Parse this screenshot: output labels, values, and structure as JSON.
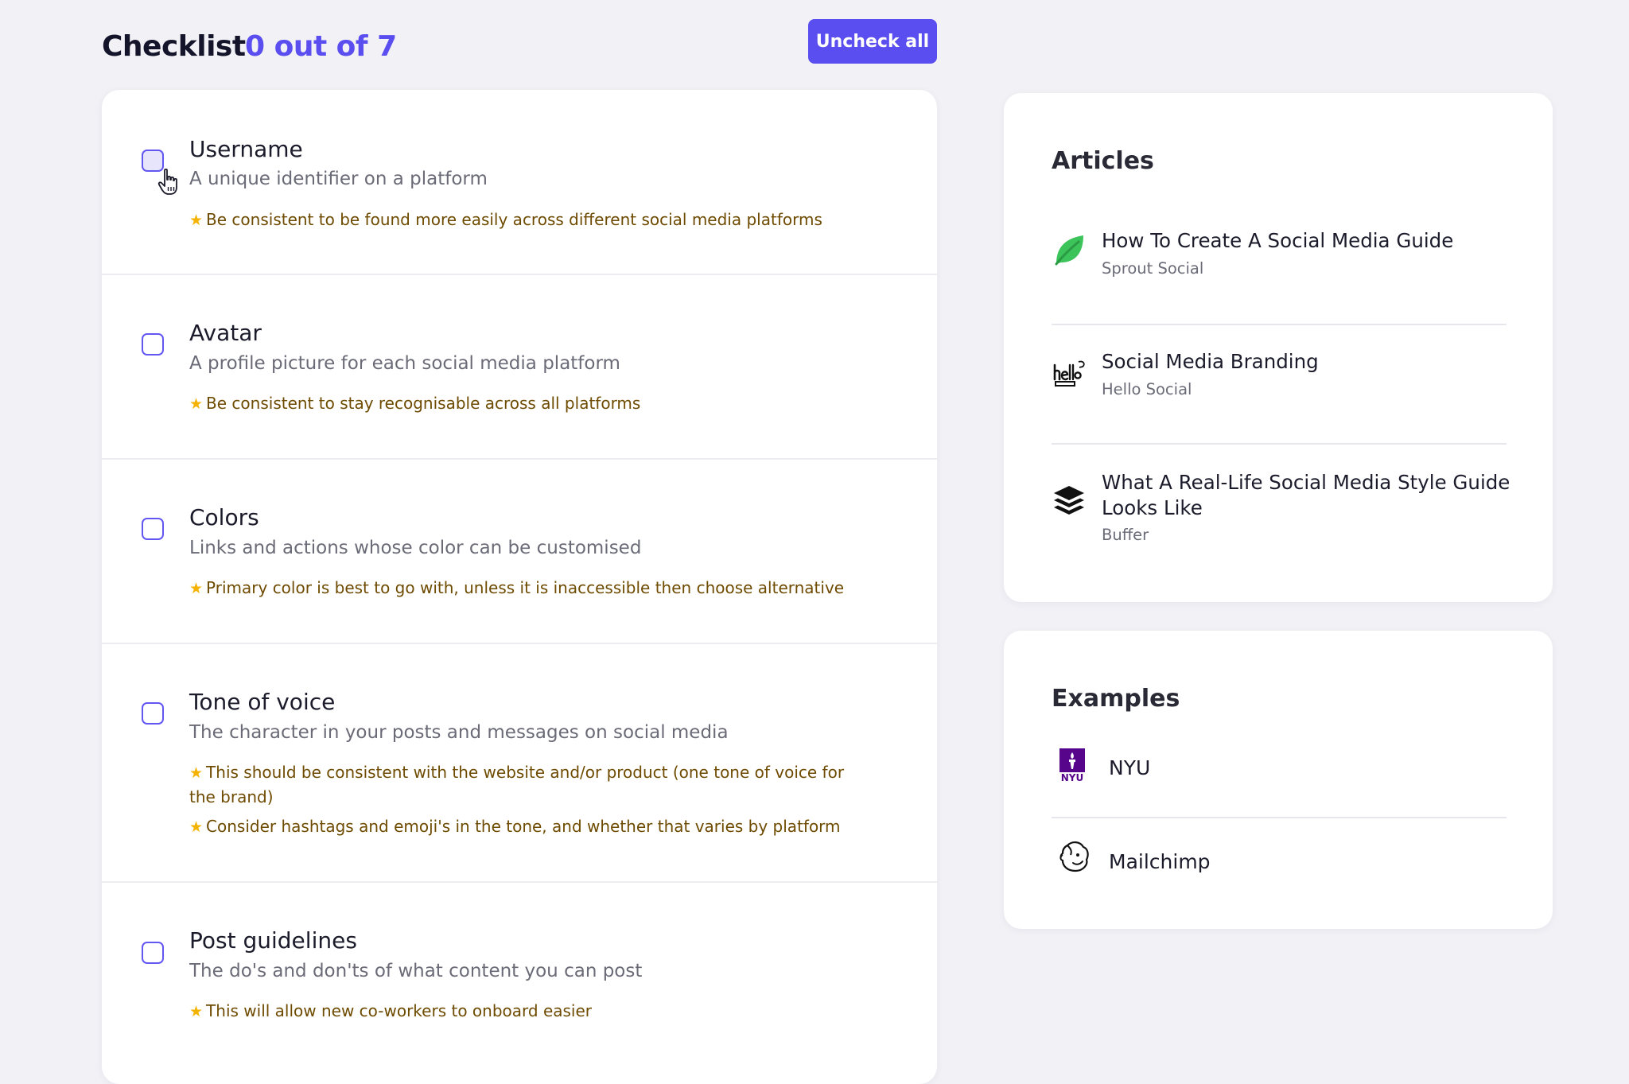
{
  "header": {
    "title": "Checklist",
    "progress": "0 out of 7",
    "uncheck_all_label": "Uncheck all"
  },
  "checklist": {
    "items": [
      {
        "title": "Username",
        "description": "A unique identifier on a platform",
        "tips": [
          "Be consistent to be found more easily across different social media platforms"
        ],
        "checked": false
      },
      {
        "title": "Avatar",
        "description": "A profile picture for each social media platform",
        "tips": [
          "Be consistent to stay recognisable across all platforms"
        ],
        "checked": false
      },
      {
        "title": "Colors",
        "description": "Links and actions whose color can be customised",
        "tips": [
          "Primary color is best to go with, unless it is inaccessible then choose alternative"
        ],
        "checked": false
      },
      {
        "title": "Tone of voice",
        "description": "The character in your posts and messages on social media",
        "tips": [
          "This should be consistent with the website and/or product (one tone of voice for the brand)",
          "Consider hashtags and emoji's in the tone, and whether that varies by platform"
        ],
        "checked": false
      },
      {
        "title": "Post guidelines",
        "description": "The do's and don'ts of what content you can post",
        "tips": [
          "This will allow new co-workers to onboard easier"
        ],
        "checked": false
      }
    ]
  },
  "articles": {
    "heading": "Articles",
    "items": [
      {
        "title": "How To Create A Social Media Guide",
        "source": "Sprout Social",
        "icon": "sprout-social-leaf-icon"
      },
      {
        "title": "Social Media Branding",
        "source": "Hello Social",
        "icon": "hello-social-logo-icon"
      },
      {
        "title": "What A Real-Life Social Media Style Guide Looks Like",
        "source": "Buffer",
        "icon": "buffer-stack-icon"
      }
    ]
  },
  "examples": {
    "heading": "Examples",
    "items": [
      {
        "label": "NYU",
        "logo_text": "NYU",
        "icon": "nyu-torch-logo-icon"
      },
      {
        "label": "Mailchimp",
        "icon": "mailchimp-freddie-logo-icon"
      }
    ]
  },
  "colors": {
    "accent": "#5b4ef0",
    "background": "#f1f1f6",
    "card": "#ffffff",
    "tip_text": "#6e4b00",
    "star": "#f5b301",
    "sprout_green": "#3cc35a",
    "nyu_purple": "#57068c"
  }
}
